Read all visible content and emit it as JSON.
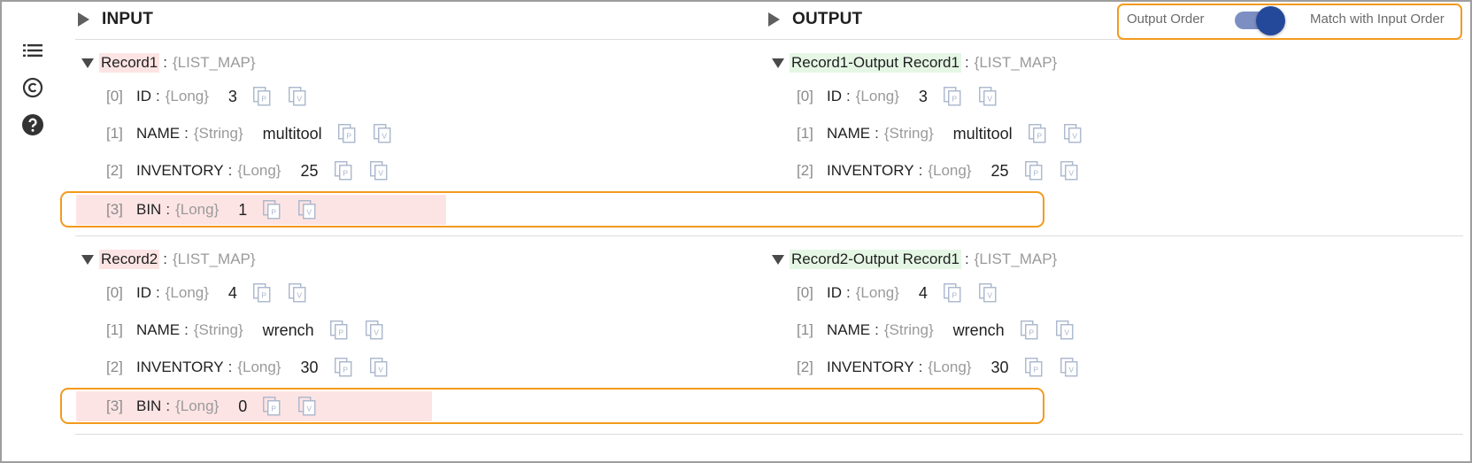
{
  "header": {
    "input_label": "INPUT",
    "output_label": "OUTPUT",
    "order_toggle": {
      "left_label": "Output Order",
      "right_label": "Match with Input Order",
      "state": "on",
      "track_color": "#7d8fc2",
      "knob_color": "#25499a"
    }
  },
  "sidebar": {
    "icons": [
      "list-icon",
      "copyright-icon",
      "help-icon"
    ]
  },
  "highlight_color": "#f39a1d",
  "input_records": [
    {
      "name": "Record1",
      "type": "{LIST_MAP}",
      "fields": [
        {
          "index": "[0]",
          "name": "ID",
          "type": "{Long}",
          "value": "3"
        },
        {
          "index": "[1]",
          "name": "NAME",
          "type": "{String}",
          "value": "multitool"
        },
        {
          "index": "[2]",
          "name": "INVENTORY",
          "type": "{Long}",
          "value": "25"
        },
        {
          "index": "[3]",
          "name": "BIN",
          "type": "{Long}",
          "value": "1"
        }
      ]
    },
    {
      "name": "Record2",
      "type": "{LIST_MAP}",
      "fields": [
        {
          "index": "[0]",
          "name": "ID",
          "type": "{Long}",
          "value": "4"
        },
        {
          "index": "[1]",
          "name": "NAME",
          "type": "{String}",
          "value": "wrench"
        },
        {
          "index": "[2]",
          "name": "INVENTORY",
          "type": "{Long}",
          "value": "30"
        },
        {
          "index": "[3]",
          "name": "BIN",
          "type": "{Long}",
          "value": "0"
        }
      ]
    }
  ],
  "output_records": [
    {
      "name": "Record1-Output Record1",
      "type": "{LIST_MAP}",
      "fields": [
        {
          "index": "[0]",
          "name": "ID",
          "type": "{Long}",
          "value": "3"
        },
        {
          "index": "[1]",
          "name": "NAME",
          "type": "{String}",
          "value": "multitool"
        },
        {
          "index": "[2]",
          "name": "INVENTORY",
          "type": "{Long}",
          "value": "25"
        }
      ]
    },
    {
      "name": "Record2-Output Record1",
      "type": "{LIST_MAP}",
      "fields": [
        {
          "index": "[0]",
          "name": "ID",
          "type": "{Long}",
          "value": "4"
        },
        {
          "index": "[1]",
          "name": "NAME",
          "type": "{String}",
          "value": "wrench"
        },
        {
          "index": "[2]",
          "name": "INVENTORY",
          "type": "{Long}",
          "value": "30"
        }
      ]
    }
  ],
  "separator": ":"
}
